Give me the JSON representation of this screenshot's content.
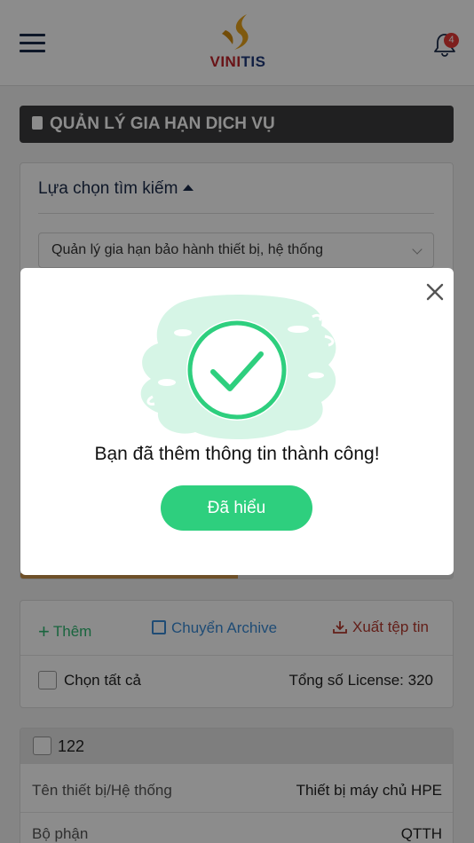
{
  "header": {
    "brand_part1": "VINI",
    "brand_part2": "TIS",
    "notification_count": "4"
  },
  "page_title": "QUẢN LÝ GIA HẠN DỊCH VỤ",
  "search": {
    "heading": "Lựa chọn tìm kiếm",
    "selected_option": "Quản lý gia hạn bảo hành thiết bị, hệ thống",
    "progress_fraction": 0.5
  },
  "actions": {
    "add_label": "Thêm",
    "archive_label": "Chuyển Archive",
    "export_label": "Xuất tệp tin",
    "select_all_label": "Chọn tất cả",
    "license_total": "Tổng số License: 320"
  },
  "items": [
    {
      "number": "122",
      "fields": [
        {
          "label": "Tên thiết bị/Hệ thống",
          "value": "Thiết bị máy chủ HPE"
        },
        {
          "label": "Bộ phận",
          "value": "QTTH"
        }
      ]
    }
  ],
  "modal": {
    "message": "Bạn đã thêm thông tin thành công!",
    "confirm_label": "Đã hiểu"
  },
  "colors": {
    "header_bg": "#ffffff",
    "title_bar": "#3b3b3d",
    "add_green": "#2eb872",
    "archive_blue": "#3a8ad6",
    "export_red": "#b53a2f",
    "success_green": "#2ecf7e",
    "success_blob": "#d6f5e6",
    "progress": "#c8934a"
  },
  "icons": {
    "menu": "hamburger-icon",
    "notifications": "bell-icon",
    "title": "clipboard-icon",
    "success": "check-circle-icon",
    "close": "close-icon"
  }
}
